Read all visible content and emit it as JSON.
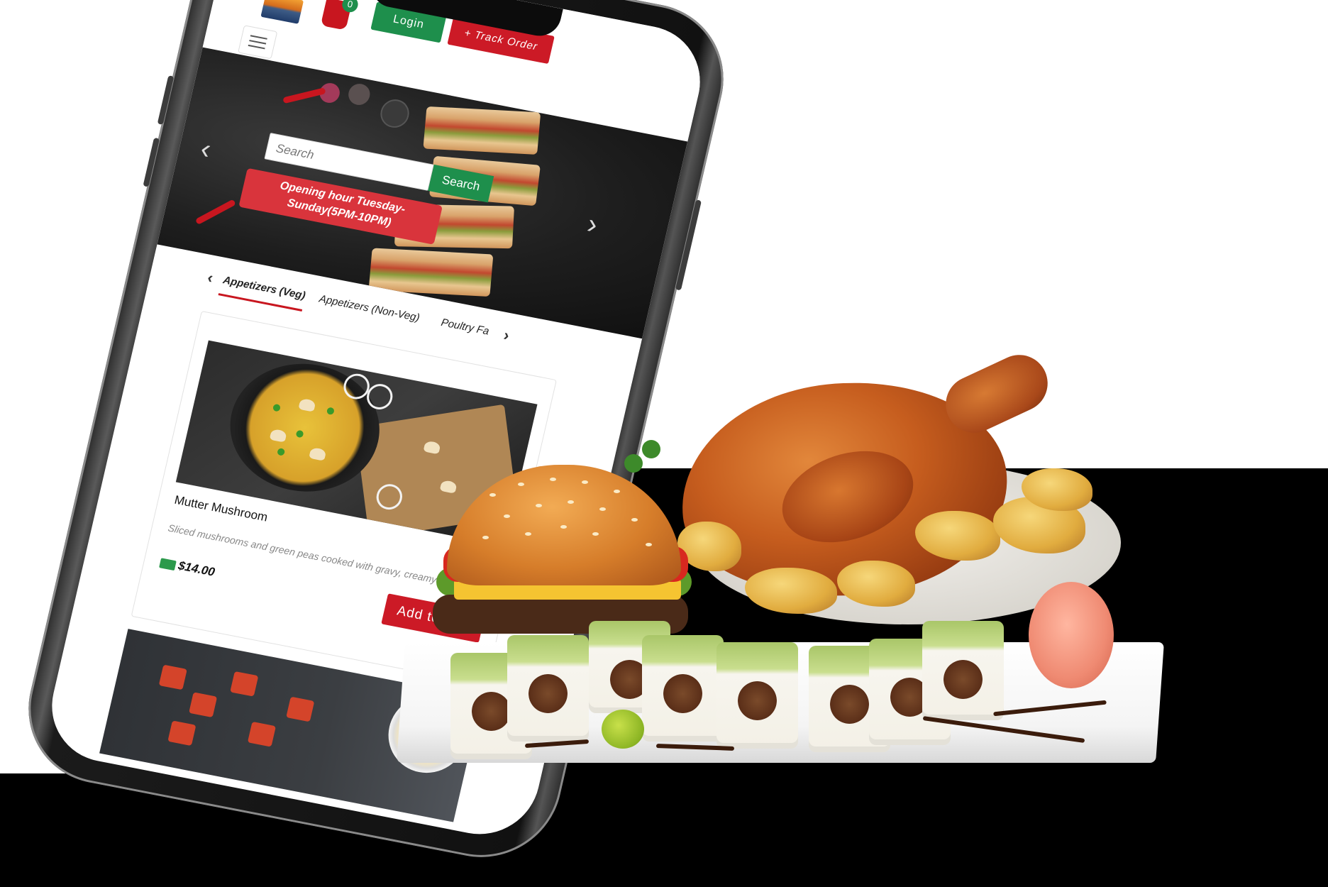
{
  "header": {
    "cart_count": "0",
    "login_label": "Login",
    "track_order_label": "Track Order"
  },
  "banner": {
    "search_placeholder": "Search",
    "search_button": "Search",
    "opening_hours": "Opening hour Tuesday-Sunday(5PM-10PM)"
  },
  "tabs": [
    {
      "label": "Appetizers (Veg)",
      "active": true
    },
    {
      "label": "Appetizers (Non-Veg)",
      "active": false
    },
    {
      "label": "Poultry Fa",
      "active": false
    }
  ],
  "menu_item": {
    "title": "Mutter Mushroom",
    "description": "Sliced mushrooms and green peas cooked with gravy, creamy",
    "price": "$14.00",
    "add_button": "Add to Bag"
  },
  "icons": [
    "menu-icon",
    "cart-icon",
    "chevron-left-icon",
    "chevron-right-icon",
    "money-icon"
  ],
  "colors": {
    "accent_red": "#cc1a26",
    "accent_green": "#1e8f4c"
  }
}
